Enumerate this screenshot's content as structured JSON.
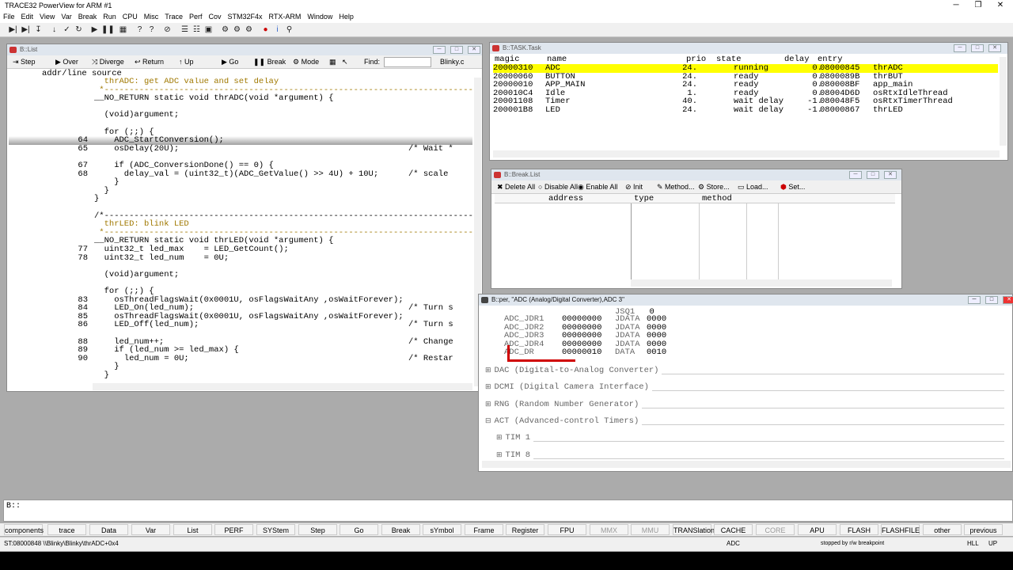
{
  "app": {
    "title": "TRACE32 PowerView for ARM #1"
  },
  "menu": [
    "File",
    "Edit",
    "View",
    "Var",
    "Break",
    "Run",
    "CPU",
    "Misc",
    "Trace",
    "Perf",
    "Cov",
    "STM32F4x",
    "RTX-ARM",
    "Window",
    "Help"
  ],
  "list_window": {
    "title": "B::List",
    "toolbar": {
      "step": "Step",
      "over": "Over",
      "diverge": "Diverge",
      "return": "Return",
      "up": "Up",
      "go": "Go",
      "break": "Break",
      "mode": "Mode",
      "find": "Find:",
      "file": "Blinky.c"
    },
    "header": "addr/line source",
    "lines": [
      {
        "n": "",
        "t": "  thrADC: get ADC value and set delay",
        "c": "cmt"
      },
      {
        "n": "",
        "t": " *--------------------------------------------------------------------------",
        "c": "cmt"
      },
      {
        "n": "",
        "t": "__NO_RETURN static void thrADC(void *argument) {",
        "c": ""
      },
      {
        "n": "",
        "t": "",
        "c": ""
      },
      {
        "n": "",
        "t": "  (void)argument;",
        "c": ""
      },
      {
        "n": "",
        "t": "",
        "c": ""
      },
      {
        "n": "",
        "t": "  for (;;) {",
        "c": ""
      },
      {
        "n": "64",
        "t": "    ADC_StartConversion();",
        "c": "hl"
      },
      {
        "n": "65",
        "t": "    osDelay(20U);                                              /* Wait *",
        "c": ""
      },
      {
        "n": "",
        "t": "",
        "c": ""
      },
      {
        "n": "67",
        "t": "    if (ADC_ConversionDone() == 0) {",
        "c": ""
      },
      {
        "n": "68",
        "t": "      delay_val = (uint32_t)(ADC_GetValue() >> 4U) + 10U;      /* scale",
        "c": ""
      },
      {
        "n": "",
        "t": "    }",
        "c": ""
      },
      {
        "n": "",
        "t": "  }",
        "c": ""
      },
      {
        "n": "",
        "t": "}",
        "c": ""
      },
      {
        "n": "",
        "t": "",
        "c": ""
      },
      {
        "n": "",
        "t": "/*--------------------------------------------------------------------------",
        "c": "cmt"
      },
      {
        "n": "",
        "t": "  thrLED: blink LED",
        "c": "cmt"
      },
      {
        "n": "",
        "t": " *--------------------------------------------------------------------------",
        "c": "cmt"
      },
      {
        "n": "",
        "t": "__NO_RETURN static void thrLED(void *argument) {",
        "c": ""
      },
      {
        "n": "77",
        "t": "  uint32_t led_max    = LED_GetCount();",
        "c": ""
      },
      {
        "n": "78",
        "t": "  uint32_t led_num    = 0U;",
        "c": ""
      },
      {
        "n": "",
        "t": "",
        "c": ""
      },
      {
        "n": "",
        "t": "  (void)argument;",
        "c": ""
      },
      {
        "n": "",
        "t": "",
        "c": ""
      },
      {
        "n": "",
        "t": "  for (;;) {",
        "c": ""
      },
      {
        "n": "83",
        "t": "    osThreadFlagsWait(0x0001U, osFlagsWaitAny ,osWaitForever);",
        "c": ""
      },
      {
        "n": "84",
        "t": "    LED_On(led_num);                                           /* Turn s",
        "c": ""
      },
      {
        "n": "85",
        "t": "    osThreadFlagsWait(0x0001U, osFlagsWaitAny ,osWaitForever);",
        "c": ""
      },
      {
        "n": "86",
        "t": "    LED_Off(led_num);                                          /* Turn s",
        "c": ""
      },
      {
        "n": "",
        "t": "",
        "c": ""
      },
      {
        "n": "88",
        "t": "    led_num++;                                                 /* Change",
        "c": ""
      },
      {
        "n": "89",
        "t": "    if (led_num >= led_max) {",
        "c": ""
      },
      {
        "n": "90",
        "t": "      led_num = 0U;                                            /* Restar",
        "c": ""
      },
      {
        "n": "",
        "t": "    }",
        "c": ""
      },
      {
        "n": "",
        "t": "  }",
        "c": ""
      }
    ]
  },
  "task_window": {
    "title": "B::TASK.Task",
    "headers": {
      "magic": "magic",
      "name": "name",
      "prio": "prio",
      "state": "state",
      "delay": "delay",
      "entry": "entry"
    },
    "rows": [
      {
        "magic": "20000310",
        "name": "ADC",
        "prio": "24.",
        "state": "running",
        "delay": "0.",
        "addr": "08000845",
        "fn": "thrADC"
      },
      {
        "magic": "20000060",
        "name": "BUTTON",
        "prio": "24.",
        "state": "ready",
        "delay": "0.",
        "addr": "0800089B",
        "fn": "thrBUT"
      },
      {
        "magic": "20000010",
        "name": "APP_MAIN",
        "prio": "24.",
        "state": "ready",
        "delay": "0.",
        "addr": "080008BF",
        "fn": "app_main"
      },
      {
        "magic": "200010C4",
        "name": "Idle",
        "prio": "1.",
        "state": "ready",
        "delay": "0.",
        "addr": "08004D6D",
        "fn": "osRtxIdleThread"
      },
      {
        "magic": "20001108",
        "name": "Timer",
        "prio": "40.",
        "state": "wait delay",
        "delay": "-1.",
        "addr": "080048F5",
        "fn": "osRtxTimerThread"
      },
      {
        "magic": "200001B8",
        "name": "LED",
        "prio": "24.",
        "state": "wait delay",
        "delay": "-1.",
        "addr": "08000867",
        "fn": "thrLED"
      }
    ]
  },
  "break_window": {
    "title": "B::Break.List",
    "toolbar": {
      "delete_all": "Delete All",
      "disable_all": "Disable All",
      "enable_all": "Enable All",
      "init": "Init",
      "method": "Method...",
      "store": "Store...",
      "load": "Load...",
      "set": "Set..."
    },
    "headers": {
      "address": "address",
      "type": "type",
      "method": "method"
    }
  },
  "per_window": {
    "title": "B::per, \"ADC (Analog/Digital Converter),ADC 3\"",
    "top_label": "JSQ1",
    "top_value": "0",
    "registers": [
      {
        "name": "ADC_JDR1",
        "value": "00000000",
        "field": "JDATA",
        "fv": "0000"
      },
      {
        "name": "ADC_JDR2",
        "value": "00000000",
        "field": "JDATA",
        "fv": "0000"
      },
      {
        "name": "ADC_JDR3",
        "value": "00000000",
        "field": "JDATA",
        "fv": "0000"
      },
      {
        "name": "ADC_JDR4",
        "value": "00000000",
        "field": "JDATA",
        "fv": "0000"
      },
      {
        "name": "ADC_DR",
        "value": "00000010",
        "field": "DATA",
        "fv": "0010"
      }
    ],
    "groups": [
      {
        "sign": "⊞",
        "label": "DAC (Digital-to-Analog Converter)",
        "indent": 0
      },
      {
        "sign": "⊞",
        "label": "DCMI (Digital Camera Interface)",
        "indent": 0
      },
      {
        "sign": "⊞",
        "label": "RNG (Random Number Generator)",
        "indent": 0
      },
      {
        "sign": "⊟",
        "label": "ACT (Advanced-control Timers)",
        "indent": 0
      },
      {
        "sign": "⊞",
        "label": "TIM 1",
        "indent": 1
      },
      {
        "sign": "⊞",
        "label": "TIM 8",
        "indent": 1
      }
    ]
  },
  "command_line": "B::",
  "softkeys": [
    {
      "label": "components",
      "on": true
    },
    {
      "label": "trace",
      "on": true
    },
    {
      "label": "Data",
      "on": true
    },
    {
      "label": "Var",
      "on": true
    },
    {
      "label": "List",
      "on": true
    },
    {
      "label": "PERF",
      "on": true
    },
    {
      "label": "SYStem",
      "on": true
    },
    {
      "label": "Step",
      "on": true
    },
    {
      "label": "Go",
      "on": true
    },
    {
      "label": "Break",
      "on": true
    },
    {
      "label": "sYmbol",
      "on": true
    },
    {
      "label": "Frame",
      "on": true
    },
    {
      "label": "Register",
      "on": true
    },
    {
      "label": "FPU",
      "on": true
    },
    {
      "label": "MMX",
      "on": false
    },
    {
      "label": "MMU",
      "on": false
    },
    {
      "label": "TRANSlation",
      "on": true
    },
    {
      "label": "CACHE",
      "on": true
    },
    {
      "label": "CORE",
      "on": false
    },
    {
      "label": "APU",
      "on": true
    },
    {
      "label": "FLASH",
      "on": true
    },
    {
      "label": "FLASHFILE",
      "on": true
    },
    {
      "label": "other",
      "on": true
    },
    {
      "label": "previous",
      "on": true
    }
  ],
  "status": {
    "address": "ST:08000848  \\\\Blinky\\Blinky\\thrADC+0x4",
    "module": "ADC",
    "state": "stopped by r/w breakpoint",
    "mode": "HLL",
    "dir": "UP"
  },
  "colors": {
    "highlight_row": "#ffff00",
    "comment": "#a07800",
    "code_pink_underline": "#e87aa0",
    "marker_red": "#d00000"
  }
}
